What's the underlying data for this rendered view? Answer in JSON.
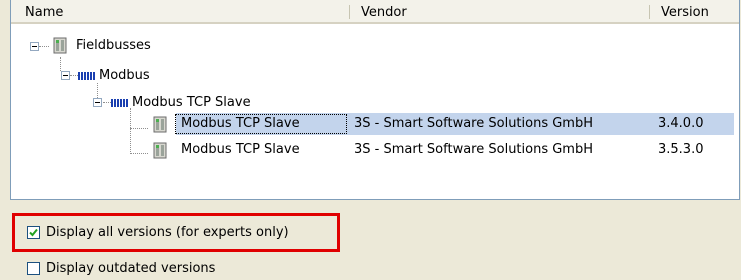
{
  "columns": {
    "name": "Name",
    "vendor": "Vendor",
    "version": "Version"
  },
  "tree": {
    "fieldbusses": {
      "label": "Fieldbusses"
    },
    "modbus": {
      "label": "Modbus"
    },
    "modbus_tcp_slave_group": {
      "label": "Modbus TCP Slave"
    },
    "devices": [
      {
        "name": "Modbus TCP Slave",
        "vendor": "3S - Smart Software Solutions GmbH",
        "version": "3.4.0.0",
        "selected": true
      },
      {
        "name": "Modbus TCP Slave",
        "vendor": "3S - Smart Software Solutions GmbH",
        "version": "3.5.3.0",
        "selected": false
      }
    ]
  },
  "options": {
    "display_all_versions": {
      "label": "Display all versions (for experts only)",
      "checked": true
    },
    "display_outdated_versions": {
      "label": "Display outdated versions",
      "checked": false
    }
  },
  "colors": {
    "selection": "#c3d4ec",
    "highlight_box": "#e00000",
    "checkbox_border": "#1c5180"
  },
  "icons": {
    "expander": "minus-expander-icon",
    "device": "fieldbus-device-icon",
    "modbus": "modbus-icon",
    "check": "checkmark-icon"
  }
}
